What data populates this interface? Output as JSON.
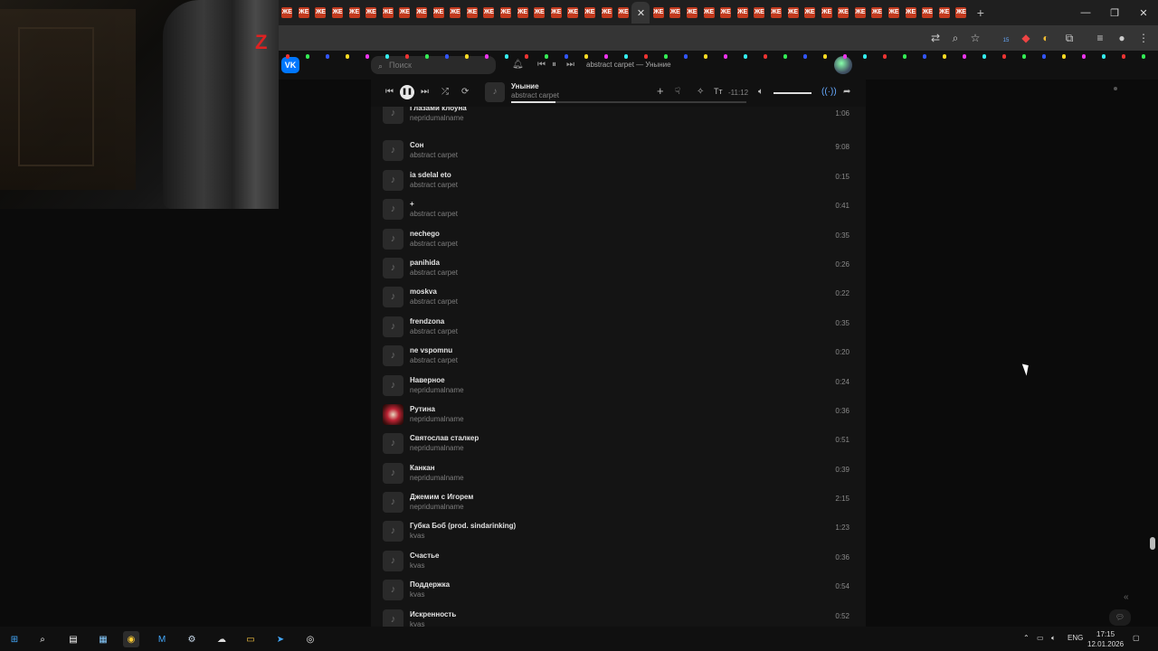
{
  "browser": {
    "tab_favicon_label": "ЖЕ",
    "new_tab_label": "+",
    "close_tab_label": "✕",
    "window_controls": {
      "minimize": "—",
      "restore": "❐",
      "close": "✕"
    },
    "extension_badge_count": "15"
  },
  "vk": {
    "logo_label": "VK",
    "search_placeholder": "Поиск",
    "header_now_playing": "abstract carpet — Уныние"
  },
  "player": {
    "title": "Уныние",
    "artist": "abstract carpet",
    "time_remaining": "-11:12",
    "text_size_label": "Тт",
    "progress_fraction": 0.19,
    "volume_fraction": 1.0
  },
  "tracks": [
    {
      "title": "Глазами клоуна",
      "artist": "nepridumalname",
      "duration": "1:06",
      "has_cover": false
    },
    {
      "title": "Сон",
      "artist": "abstract carpet",
      "duration": "9:08",
      "has_cover": false
    },
    {
      "title": "ia sdelal eto",
      "artist": "abstract carpet",
      "duration": "0:15",
      "has_cover": false
    },
    {
      "title": "+",
      "artist": "abstract carpet",
      "duration": "0:41",
      "has_cover": false
    },
    {
      "title": "nechego",
      "artist": "abstract carpet",
      "duration": "0:35",
      "has_cover": false
    },
    {
      "title": "panihida",
      "artist": "abstract carpet",
      "duration": "0:26",
      "has_cover": false
    },
    {
      "title": "moskva",
      "artist": "abstract carpet",
      "duration": "0:22",
      "has_cover": false
    },
    {
      "title": "frendzona",
      "artist": "abstract carpet",
      "duration": "0:35",
      "has_cover": false
    },
    {
      "title": "ne vspomnu",
      "artist": "abstract carpet",
      "duration": "0:20",
      "has_cover": false
    },
    {
      "title": "Наверное",
      "artist": "nepridumalname",
      "duration": "0:24",
      "has_cover": false
    },
    {
      "title": "Рутина",
      "artist": "nepridumalname",
      "duration": "0:36",
      "has_cover": true
    },
    {
      "title": "Святослав сталкер",
      "artist": "nepridumalname",
      "duration": "0:51",
      "has_cover": false
    },
    {
      "title": "Канкан",
      "artist": "nepridumalname",
      "duration": "0:39",
      "has_cover": false
    },
    {
      "title": "Джемим с Игорем",
      "artist": "nepridumalname",
      "duration": "2:15",
      "has_cover": false
    },
    {
      "title": "Губка Боб (prod. sindarinking)",
      "artist": "kvas",
      "duration": "1:23",
      "has_cover": false
    },
    {
      "title": "Счастье",
      "artist": "kvas",
      "duration": "0:36",
      "has_cover": false
    },
    {
      "title": "Поддержка",
      "artist": "kvas",
      "duration": "0:54",
      "has_cover": false
    },
    {
      "title": "Искренность",
      "artist": "kvas",
      "duration": "0:52",
      "has_cover": false
    }
  ],
  "taskbar": {
    "language": "ENG",
    "time": "17:15",
    "date": "12.01.2026"
  },
  "colors": {
    "vk_blue": "#0077ff",
    "favicon_red": "#c23a1e",
    "list_bg": "#141414"
  }
}
